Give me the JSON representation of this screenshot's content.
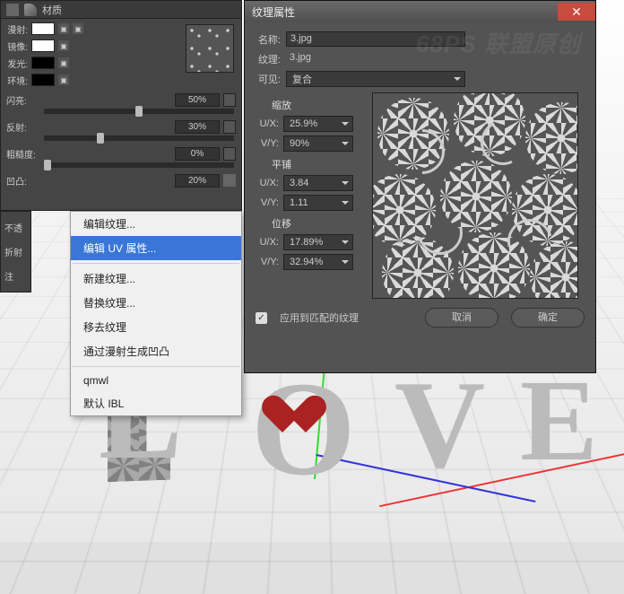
{
  "watermark": "68PS 联盟原创",
  "material_panel": {
    "title": "材质",
    "rows": {
      "diffuse": "漫射:",
      "specular": "镜像:",
      "glow": "发光:",
      "env": "环境:"
    },
    "sliders": {
      "shine_label": "闪亮:",
      "shine_value": "50%",
      "reflect_label": "反射:",
      "reflect_value": "30%",
      "rough_label": "粗糙度:",
      "rough_value": "0%",
      "bump_label": "凹凸:",
      "bump_value": "20%"
    },
    "not_transparent": "不透",
    "refraction": "折射",
    "note": "注"
  },
  "context_menu": {
    "items": [
      "编辑纹理...",
      "编辑 UV 属性...",
      "新建纹理...",
      "替换纹理...",
      "移去纹理",
      "通过漫射生成凹凸",
      "qmwl",
      "默认 IBL"
    ]
  },
  "texture_properties": {
    "title": "纹理属性",
    "name_lbl": "名称:",
    "name_val": "3.jpg",
    "tex_lbl": "纹理:",
    "tex_val": "3.jpg",
    "visible_lbl": "可见:",
    "visible_val": "复合",
    "sections": {
      "scale": "缩放",
      "tile": "平铺",
      "offset": "位移"
    },
    "scale": {
      "ux_lbl": "U/X:",
      "ux_val": "25.9%",
      "vy_lbl": "V/Y:",
      "vy_val": "90%"
    },
    "tile": {
      "ux_lbl": "U/X:",
      "ux_val": "3.84",
      "vy_lbl": "V/Y:",
      "vy_val": "1.11"
    },
    "offset": {
      "ux_lbl": "U/X:",
      "ux_val": "17.89%",
      "vy_lbl": "V/Y:",
      "vy_val": "32.94%"
    },
    "apply_lbl": "应用到匹配的纹理",
    "cancel": "取消",
    "ok": "确定"
  }
}
